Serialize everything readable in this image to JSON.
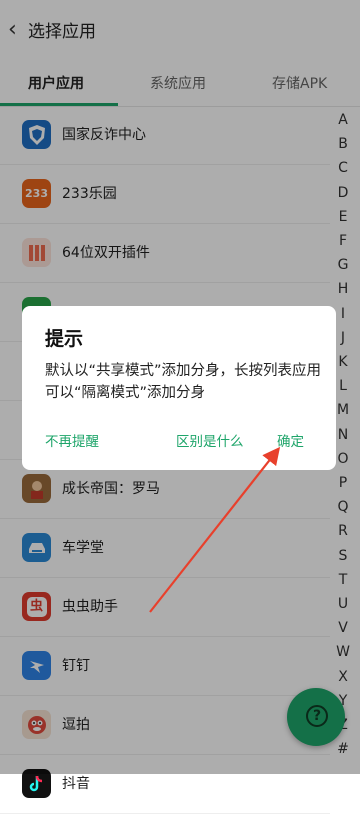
{
  "header": {
    "title": "选择应用"
  },
  "tabs": [
    {
      "label": "用户应用"
    },
    {
      "label": "系统应用"
    },
    {
      "label": "存储APK"
    }
  ],
  "apps": [
    {
      "name": "国家反诈中心",
      "color": "#1f6fc4"
    },
    {
      "name": "233乐园",
      "badge": "233",
      "color": "#e9651b"
    },
    {
      "name": "64位双开插件",
      "color": "#ef6b4e"
    },
    {
      "name": "",
      "color": "#2aa64a"
    },
    {
      "name": "",
      "color": "#3b7fe0"
    },
    {
      "name": "",
      "color": "#777777"
    },
    {
      "name": "成长帝国：罗马",
      "color": "#9a6b3c"
    },
    {
      "name": "车学堂",
      "color": "#2a8ad6"
    },
    {
      "name": "虫虫助手",
      "badge": "虫",
      "color": "#e03b2f"
    },
    {
      "name": "钉钉",
      "color": "#2f84e8"
    },
    {
      "name": "逗拍",
      "color": "#e24b3d"
    },
    {
      "name": "抖音",
      "color": "#111111"
    }
  ],
  "index_letters": [
    "A",
    "B",
    "C",
    "D",
    "E",
    "F",
    "G",
    "H",
    "I",
    "J",
    "K",
    "L",
    "M",
    "N",
    "O",
    "P",
    "Q",
    "R",
    "S",
    "T",
    "U",
    "V",
    "W",
    "X",
    "Y",
    "Z",
    "#"
  ],
  "dialog": {
    "title": "提示",
    "message": "默认以“共享模式”添加分身，长按列表应用可以“隔离模式”添加分身",
    "btn_dont_remind": "不再提醒",
    "btn_difference": "区别是什么",
    "btn_confirm": "确定"
  },
  "colors": {
    "accent": "#1ea56a",
    "arrow": "#e8402c"
  }
}
